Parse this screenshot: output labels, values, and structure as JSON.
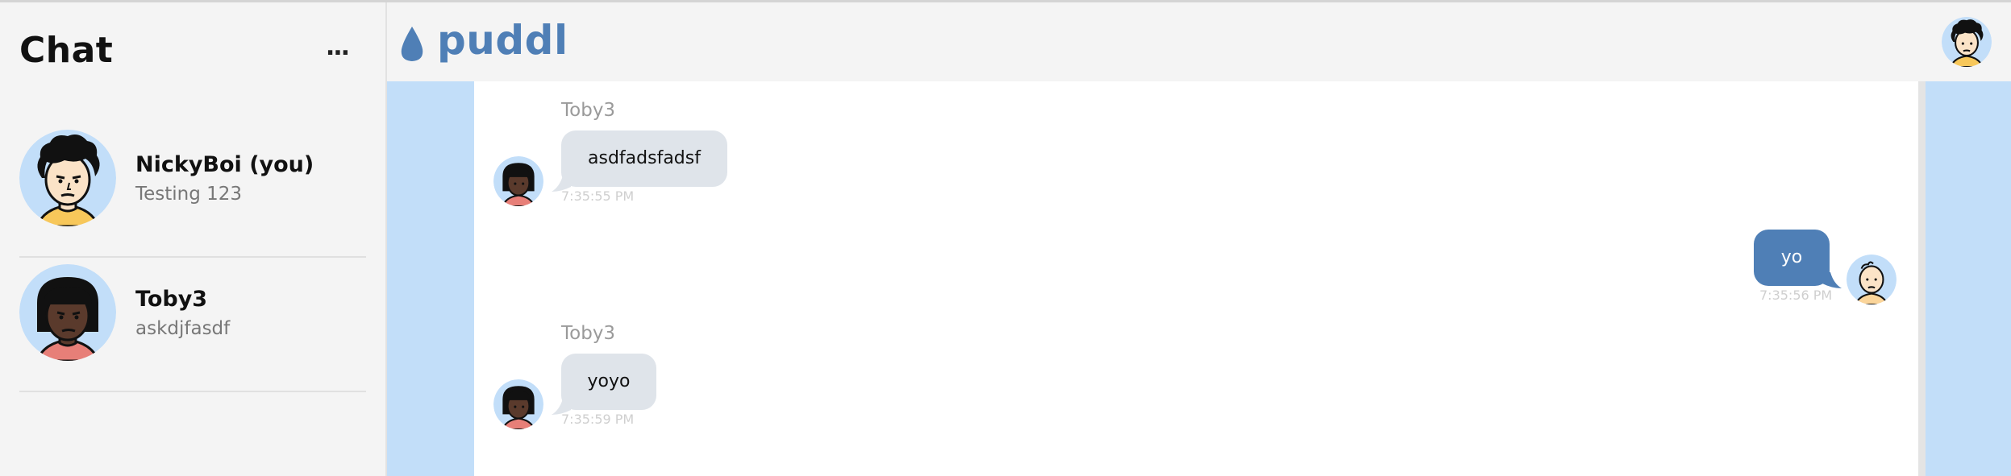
{
  "sidebar": {
    "title": "Chat",
    "more_label": "...",
    "conversations": [
      {
        "name": "NickyBoi (you)",
        "preview": "Testing 123",
        "avatar": "curly-hair-avatar"
      },
      {
        "name": "Toby3",
        "preview": "askdjfasdf",
        "avatar": "bob-hair-avatar"
      }
    ]
  },
  "header": {
    "app_name": "puddl",
    "logo_icon": "water-drop-icon",
    "user_avatar": "user-avatar"
  },
  "messages": [
    {
      "sender": "Toby3",
      "text": "asdfadsfadsf",
      "time": "7:35:55 PM",
      "direction": "incoming"
    },
    {
      "sender": "",
      "text": "yo",
      "time": "7:35:56 PM",
      "direction": "outgoing"
    },
    {
      "sender": "Toby3",
      "text": "yoyo",
      "time": "7:35:59 PM",
      "direction": "incoming"
    }
  ],
  "colors": {
    "brand": "#4f7fb6",
    "chat_background": "#c2def9",
    "incoming_bubble": "#dfe4ea",
    "outgoing_bubble": "#4f7fb6",
    "avatar_background": "#c2def9"
  }
}
